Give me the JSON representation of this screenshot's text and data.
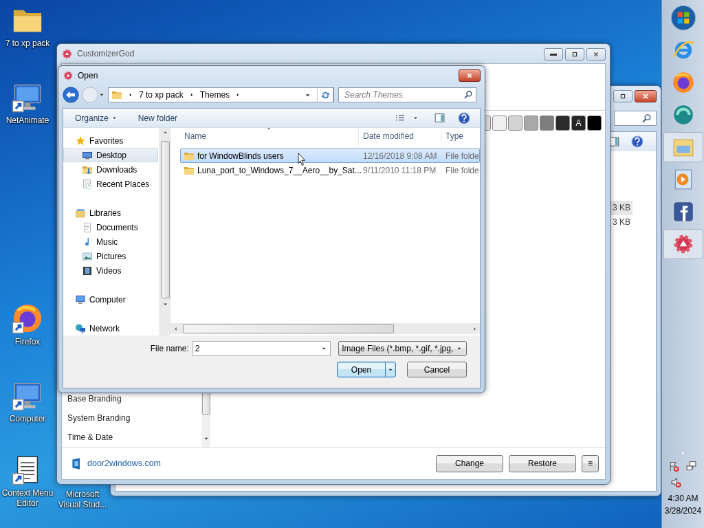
{
  "desktop_icons": [
    {
      "label": "7 to xp pack",
      "kind": "folder"
    },
    {
      "label": "NetAnimate",
      "kind": "monitor"
    },
    {
      "label": "Firefox",
      "kind": "browser"
    },
    {
      "label": "Computer",
      "kind": "computer"
    },
    {
      "label": "Context Menu Editor",
      "kind": "document"
    },
    {
      "label": "Microsoft Visual Stud...",
      "kind": "covered"
    }
  ],
  "back_window": {
    "rows": [
      {
        "size": "3 KB",
        "selected": true
      },
      {
        "size": "3 KB",
        "selected": false
      }
    ]
  },
  "customizer": {
    "title": "CustomizerGod",
    "swatches": [
      {
        "color": "#e9dfe0"
      },
      {
        "color": "#f0f0f0"
      },
      {
        "color": "#d3d3d3"
      },
      {
        "color": "#a8a8a8"
      },
      {
        "color": "#7e7e7e"
      },
      {
        "color": "#2b2b2b"
      },
      {
        "color": "#262626",
        "label": "A"
      },
      {
        "color": "#000000"
      }
    ],
    "sections": [
      "Base Branding",
      "System Branding",
      "Time & Date"
    ],
    "link": "door2windows.com",
    "buttons": [
      "Change",
      "Restore"
    ],
    "menu_button": "≡"
  },
  "dialog": {
    "title": "Open",
    "path": [
      "7 to xp pack",
      "Themes"
    ],
    "search_placeholder": "Search Themes",
    "toolbar": [
      {
        "label": "Organize",
        "kind": "menu"
      },
      {
        "label": "New folder",
        "kind": "plain"
      }
    ],
    "nav": [
      {
        "label": "Favorites",
        "kind": "star",
        "selected": false,
        "children": [
          {
            "label": "Desktop",
            "kind": "desktop",
            "selected": true
          },
          {
            "label": "Downloads",
            "kind": "downloads",
            "selected": false
          },
          {
            "label": "Recent Places",
            "kind": "recent",
            "selected": false
          }
        ]
      },
      {
        "label": "Libraries",
        "kind": "libraries",
        "selected": false,
        "children": [
          {
            "label": "Documents",
            "kind": "documents",
            "selected": false
          },
          {
            "label": "Music",
            "kind": "music",
            "selected": false
          },
          {
            "label": "Pictures",
            "kind": "pictures",
            "selected": false
          },
          {
            "label": "Videos",
            "kind": "videos",
            "selected": false
          }
        ]
      },
      {
        "label": "Computer",
        "kind": "computer",
        "selected": false
      },
      {
        "label": "Network",
        "kind": "network",
        "selected": false
      }
    ],
    "columns": [
      "Name",
      "Date modified",
      "Type"
    ],
    "rows": [
      {
        "name": "for WindowBlinds users",
        "date": "12/16/2018 9:08 AM",
        "type": "File folde",
        "selected": true
      },
      {
        "name": "Luna_port_to_Windows_7__Aero__by_Sat...",
        "date": "9/11/2010 11:18 PM",
        "type": "File folde",
        "selected": false
      }
    ],
    "file_name_label": "File name:",
    "file_name": "2",
    "file_type": "Image Files (*.bmp, *.gif, *.jpg,",
    "buttons": [
      {
        "label": "Open",
        "kind": "split"
      },
      {
        "label": "Cancel",
        "kind": "plain"
      }
    ]
  },
  "taskbar": {
    "items": [
      {
        "kind": "start",
        "selected": false
      },
      {
        "kind": "ie",
        "selected": false
      },
      {
        "kind": "firefox",
        "selected": false
      },
      {
        "kind": "swirl",
        "selected": false
      },
      {
        "kind": "explorer",
        "selected": true
      },
      {
        "kind": "media",
        "selected": false
      },
      {
        "kind": "facebook",
        "selected": false
      },
      {
        "kind": "customizer",
        "selected": true
      }
    ],
    "time": "4:30 AM",
    "date": "3/28/2024"
  }
}
